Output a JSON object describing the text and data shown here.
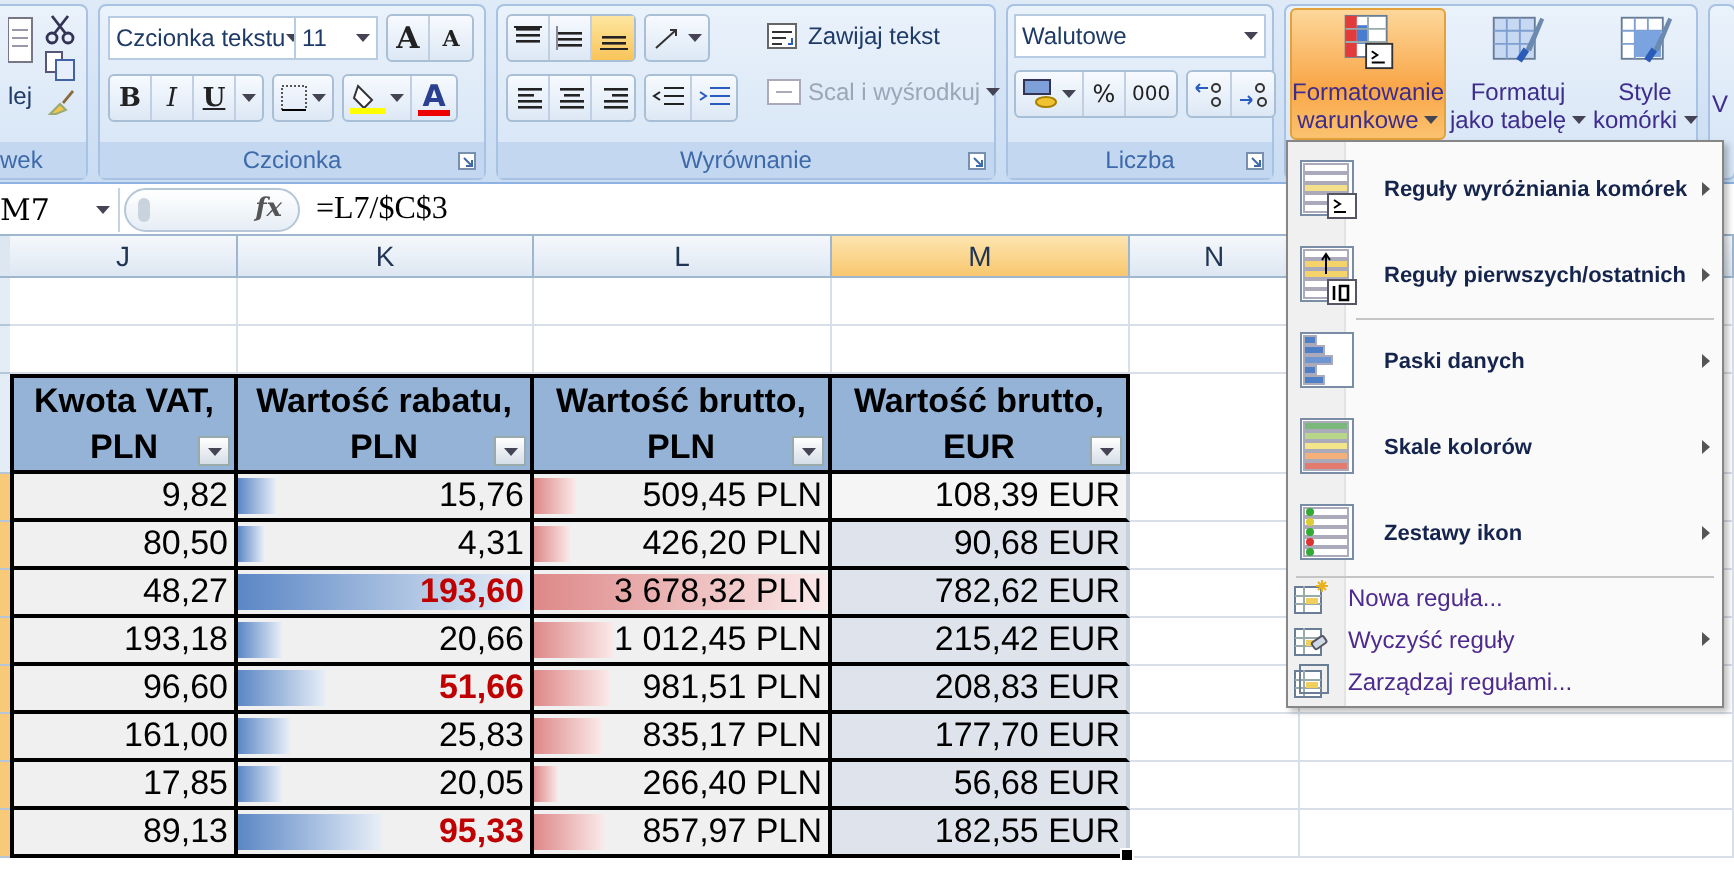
{
  "clipboard": {
    "paste": "lej",
    "label": "wek"
  },
  "font_group": {
    "label": "Czcionka",
    "font": "Czcionka tekstu",
    "size": "11",
    "grow": "A",
    "shrink": "A",
    "bold": "B",
    "italic": "I",
    "underline": "U",
    "font_color": "A"
  },
  "alignment_group": {
    "label": "Wyrównanie",
    "vertical": [
      {
        "selected": false
      },
      {
        "selected": false
      },
      {
        "selected": true
      }
    ],
    "wrap": "Zawijaj tekst",
    "merge": {
      "label": "Scal i wyśrodkuj",
      "disabled": true
    }
  },
  "number_group": {
    "label": "Liczba",
    "format": "Walutowe",
    "percent": "%",
    "thousands": "000"
  },
  "styles_group": {
    "buttons": [
      {
        "lines": [
          "Formatowanie",
          "warunkowe"
        ],
        "selected": true
      },
      {
        "lines": [
          "Formatuj",
          "jako tabelę"
        ],
        "selected": false
      },
      {
        "lines": [
          "Style",
          "komórki"
        ],
        "selected": false
      }
    ]
  },
  "next_group": {
    "label": "V"
  },
  "formula_bar": {
    "name_box": "M7",
    "fx": "fx",
    "formula": "=L7/$C$3"
  },
  "columns": [
    {
      "label": "J",
      "selected": false
    },
    {
      "label": "K",
      "selected": false
    },
    {
      "label": "L",
      "selected": false
    },
    {
      "label": "M",
      "selected": true
    },
    {
      "label": "N",
      "selected": false
    }
  ],
  "table": {
    "headers": [
      {
        "lines": [
          "Kwota VAT,",
          "PLN"
        ]
      },
      {
        "lines": [
          "Wartość rabatu,",
          "PLN"
        ]
      },
      {
        "lines": [
          "Wartość brutto,",
          "PLN"
        ]
      },
      {
        "lines": [
          "Wartość brutto,",
          "EUR"
        ]
      }
    ],
    "rows": [
      {
        "vat": "9,82",
        "discount": {
          "text": "15,76",
          "level": 0.13,
          "highlighted": false
        },
        "gross_pln": {
          "text": "509,45 PLN",
          "level": 0.14
        },
        "gross_eur": {
          "text": "108,39 EUR",
          "active": true
        }
      },
      {
        "vat": "80,50",
        "discount": {
          "text": "4,31",
          "level": 0.09,
          "highlighted": false
        },
        "gross_pln": {
          "text": "426,20 PLN",
          "level": 0.12
        },
        "gross_eur": {
          "text": "90,68 EUR",
          "active": false
        }
      },
      {
        "vat": "48,27",
        "discount": {
          "text": "193,60",
          "level": 1.0,
          "highlighted": true
        },
        "gross_pln": {
          "text": "3 678,32 PLN",
          "level": 1.0
        },
        "gross_eur": {
          "text": "782,62 EUR",
          "active": false
        }
      },
      {
        "vat": "193,18",
        "discount": {
          "text": "20,66",
          "level": 0.15,
          "highlighted": false
        },
        "gross_pln": {
          "text": "1 012,45 PLN",
          "level": 0.27
        },
        "gross_eur": {
          "text": "215,42 EUR",
          "active": false
        }
      },
      {
        "vat": "96,60",
        "discount": {
          "text": "51,66",
          "level": 0.3,
          "highlighted": true
        },
        "gross_pln": {
          "text": "981,51 PLN",
          "level": 0.26
        },
        "gross_eur": {
          "text": "208,83 EUR",
          "active": false
        }
      },
      {
        "vat": "161,00",
        "discount": {
          "text": "25,83",
          "level": 0.18,
          "highlighted": false
        },
        "gross_pln": {
          "text": "835,17 PLN",
          "level": 0.23
        },
        "gross_eur": {
          "text": "177,70 EUR",
          "active": false
        }
      },
      {
        "vat": "17,85",
        "discount": {
          "text": "20,05",
          "level": 0.15,
          "highlighted": false
        },
        "gross_pln": {
          "text": "266,40 PLN",
          "level": 0.08
        },
        "gross_eur": {
          "text": "56,68 EUR",
          "active": false
        }
      },
      {
        "vat": "89,13",
        "discount": {
          "text": "95,33",
          "level": 0.49,
          "highlighted": true
        },
        "gross_pln": {
          "text": "857,97 PLN",
          "level": 0.24
        },
        "gross_eur": {
          "text": "182,55 EUR",
          "active": false
        }
      }
    ]
  },
  "menu": {
    "items": [
      {
        "kind": "large",
        "label": "Reguły wyróżniania komórek",
        "submenu": true,
        "separator_before": false
      },
      {
        "kind": "large",
        "label": "Reguły pierwszych/ostatnich",
        "submenu": true,
        "separator_before": false
      },
      {
        "kind": "large",
        "label": "Paski danych",
        "submenu": true,
        "separator_before": true
      },
      {
        "kind": "large",
        "label": "Skale kolorów",
        "submenu": true,
        "separator_before": false
      },
      {
        "kind": "large",
        "label": "Zestawy ikon",
        "submenu": true,
        "separator_before": false
      },
      {
        "kind": "small",
        "label": "Nowa reguła...",
        "submenu": false,
        "separator_before": true
      },
      {
        "kind": "small",
        "label": "Wyczyść reguły",
        "submenu": true,
        "separator_before": false
      },
      {
        "kind": "small",
        "label": "Zarządzaj regułami...",
        "submenu": false,
        "separator_before": false
      }
    ]
  }
}
